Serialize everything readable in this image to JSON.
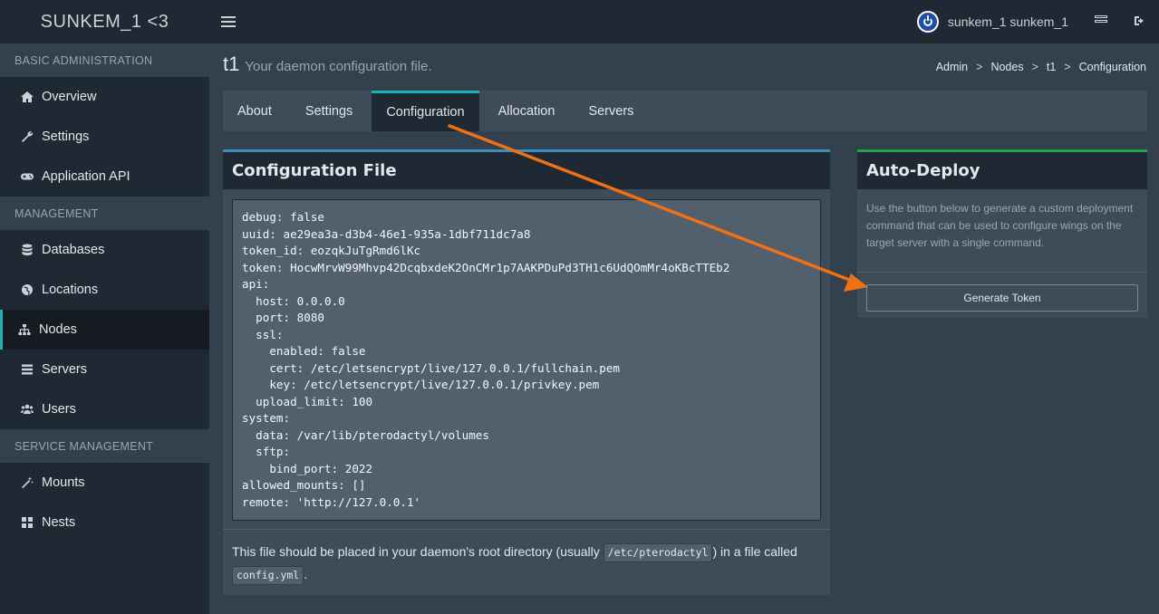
{
  "header": {
    "brand": "SUNKEM_1 <3",
    "username": "sunkem_1 sunkem_1"
  },
  "sidebar": {
    "sections": [
      {
        "title": "BASIC ADMINISTRATION",
        "items": [
          {
            "label": "Overview",
            "icon": "home-icon"
          },
          {
            "label": "Settings",
            "icon": "wrench-icon"
          },
          {
            "label": "Application API",
            "icon": "gamepad-icon"
          }
        ]
      },
      {
        "title": "MANAGEMENT",
        "items": [
          {
            "label": "Databases",
            "icon": "database-icon"
          },
          {
            "label": "Locations",
            "icon": "globe-icon"
          },
          {
            "label": "Nodes",
            "icon": "sitemap-icon",
            "active": true
          },
          {
            "label": "Servers",
            "icon": "list-icon"
          },
          {
            "label": "Users",
            "icon": "users-icon"
          }
        ]
      },
      {
        "title": "SERVICE MANAGEMENT",
        "items": [
          {
            "label": "Mounts",
            "icon": "magic-icon"
          },
          {
            "label": "Nests",
            "icon": "grid-icon"
          }
        ]
      }
    ]
  },
  "page": {
    "title": "t1",
    "subtitle": "Your daemon configuration file.",
    "breadcrumb": [
      "Admin",
      "Nodes",
      "t1",
      "Configuration"
    ]
  },
  "tabs": [
    {
      "label": "About"
    },
    {
      "label": "Settings"
    },
    {
      "label": "Configuration",
      "active": true
    },
    {
      "label": "Allocation"
    },
    {
      "label": "Servers"
    }
  ],
  "config_panel": {
    "title": "Configuration File",
    "code": "debug: false\nuuid: ae29ea3a-d3b4-46e1-935a-1dbf711dc7a8\ntoken_id: eozqkJuTgRmd6lKc\ntoken: HocwMrvW99Mhvp42DcqbxdeK2OnCMr1p7AAKPDuPd3TH1c6UdQOmMr4oKBcTTEb2\napi:\n  host: 0.0.0.0\n  port: 8080\n  ssl:\n    enabled: false\n    cert: /etc/letsencrypt/live/127.0.0.1/fullchain.pem\n    key: /etc/letsencrypt/live/127.0.0.1/privkey.pem\n  upload_limit: 100\nsystem:\n  data: /var/lib/pterodactyl/volumes\n  sftp:\n    bind_port: 2022\nallowed_mounts: []\nremote: 'http://127.0.0.1'",
    "footer_prefix": "This file should be placed in your daemon's root directory (usually ",
    "footer_path": "/etc/pterodactyl",
    "footer_middle": ") in a file called ",
    "footer_file": "config.yml",
    "footer_suffix": "."
  },
  "deploy_panel": {
    "title": "Auto-Deploy",
    "description": "Use the button below to generate a custom deployment command that can be used to configure wings on the target server with a single command.",
    "button_label": "Generate Token"
  },
  "colors": {
    "accent": "#1ab3ba",
    "config_border": "#3c8dbc",
    "deploy_border": "#22a34a",
    "annotation_arrow": "#f07014"
  }
}
